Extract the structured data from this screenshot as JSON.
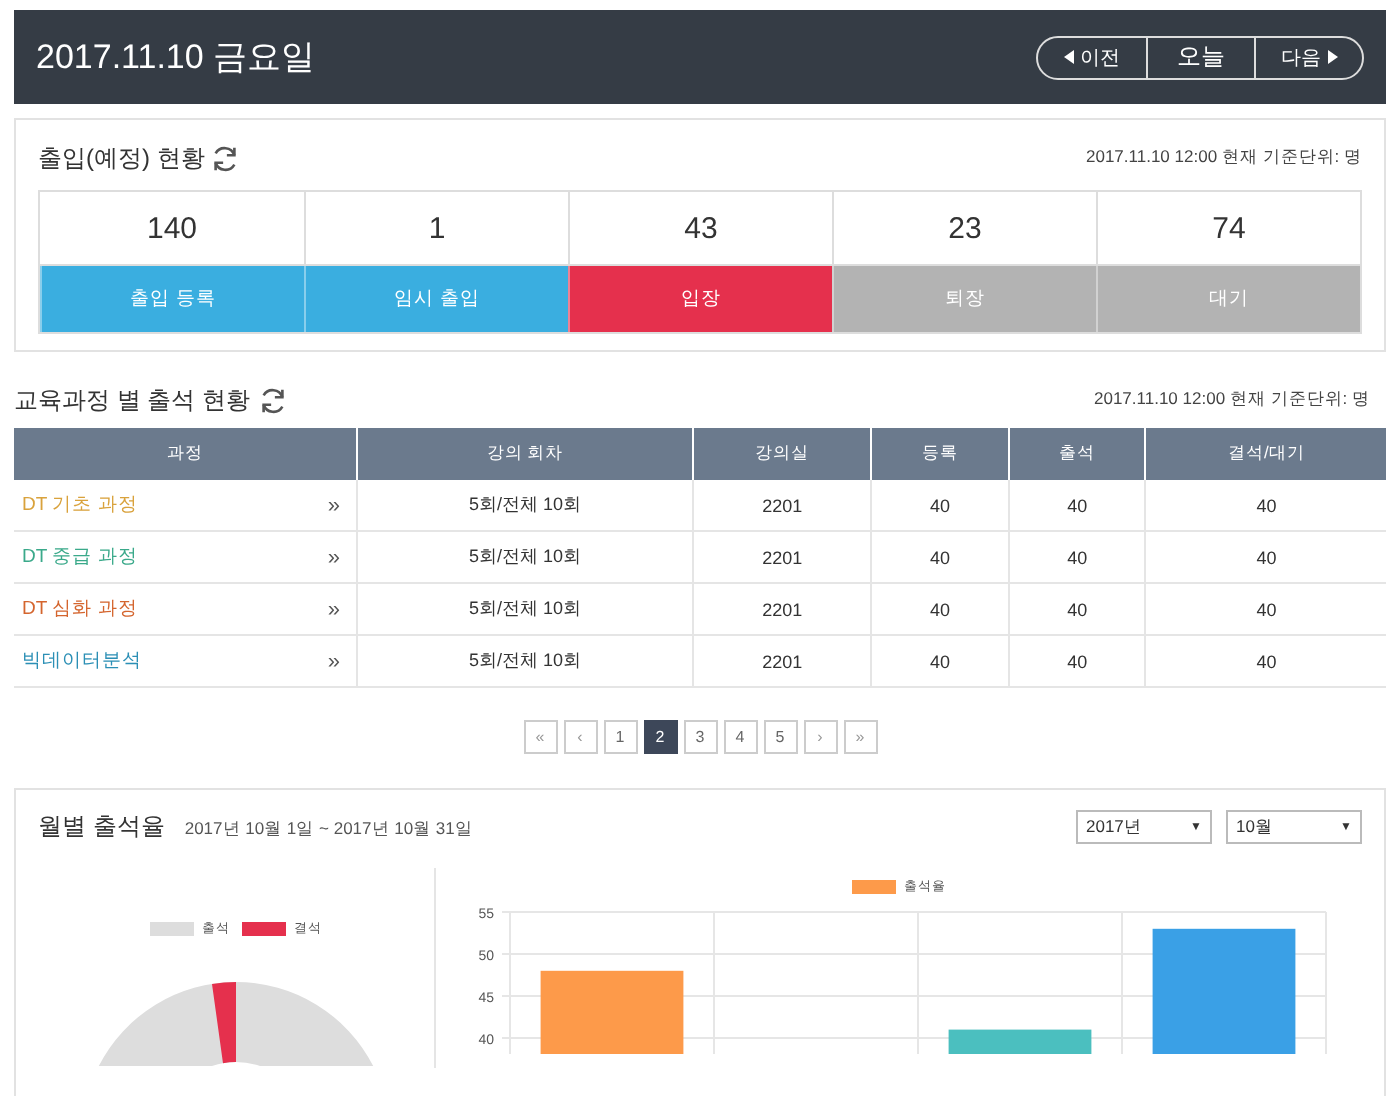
{
  "header": {
    "title": "2017.11.10 금요일",
    "nav": [
      {
        "label": "이전",
        "kind": "prev"
      },
      {
        "label": "오늘",
        "kind": "today"
      },
      {
        "label": "다음",
        "kind": "next"
      }
    ]
  },
  "entry_status": {
    "title": "출입(예정) 현황",
    "note": "2017.11.10 12:00 현재 기준단위: 명",
    "stats": [
      {
        "count": "140",
        "label": "출입 등록",
        "color": "#3aaee0"
      },
      {
        "count": "1",
        "label": "임시 출입",
        "color": "#3aaee0"
      },
      {
        "count": "43",
        "label": "입장",
        "color": "#e5304d"
      },
      {
        "count": "23",
        "label": "퇴장",
        "color": "#b3b3b3"
      },
      {
        "count": "74",
        "label": "대기",
        "color": "#b3b3b3"
      }
    ]
  },
  "attendance": {
    "title": "교육과정 별 출석 현황",
    "note": "2017.11.10 12:00 현재 기준단위: 명",
    "columns": [
      "과정",
      "강의 회차",
      "강의실",
      "등록",
      "출석",
      "결석/대기"
    ],
    "rows": [
      {
        "color": "#d9a23c",
        "link": "»",
        "cells": [
          "DT 기초 과정",
          "5회/전체 10회",
          "2201",
          "40",
          "40",
          "40"
        ]
      },
      {
        "color": "#3aa98a",
        "link": "»",
        "cells": [
          "DT 중급 과정",
          "5회/전체 10회",
          "2201",
          "40",
          "40",
          "40"
        ]
      },
      {
        "color": "#d4652e",
        "link": "»",
        "cells": [
          "DT 심화 과정",
          "5회/전체 10회",
          "2201",
          "40",
          "40",
          "40"
        ]
      },
      {
        "color": "#2b8fb5",
        "link": "»",
        "cells": [
          "빅데이터분석",
          "5회/전체 10회",
          "2201",
          "40",
          "40",
          "40"
        ]
      }
    ]
  },
  "pagination": [
    {
      "label": "«",
      "kind": "first",
      "selected": false
    },
    {
      "label": "‹",
      "kind": "prev",
      "selected": false
    },
    {
      "label": "1",
      "kind": "page",
      "selected": false
    },
    {
      "label": "2",
      "kind": "page",
      "selected": true
    },
    {
      "label": "3",
      "kind": "page",
      "selected": false
    },
    {
      "label": "4",
      "kind": "page",
      "selected": false
    },
    {
      "label": "5",
      "kind": "page",
      "selected": false
    },
    {
      "label": "›",
      "kind": "next",
      "selected": false
    },
    {
      "label": "»",
      "kind": "last",
      "selected": false
    }
  ],
  "monthly": {
    "title": "월별 출석율",
    "range": "2017년 10월 1일 ~ 2017년 10월 31일",
    "selects": [
      {
        "value": "2017년",
        "caret": "▼"
      },
      {
        "value": "10월",
        "caret": "▼"
      }
    ],
    "donut_legend": [
      {
        "label": "출석",
        "color": "#dddddd"
      },
      {
        "label": "결석",
        "color": "#e5304d"
      }
    ],
    "chart_data": {
      "type": "bar",
      "grid": true,
      "series": [
        {
          "name": "출석율",
          "color": "#fd9a4a",
          "values": [
            48,
            null,
            null,
            null
          ]
        },
        {
          "color": "#4bbfbf",
          "values": [
            null,
            null,
            41,
            null
          ]
        },
        {
          "color": "#3aa0e6",
          "values": [
            null,
            null,
            null,
            53
          ]
        }
      ],
      "ylim": [
        38,
        55
      ],
      "yticks": [
        40,
        45,
        50,
        55
      ]
    }
  }
}
